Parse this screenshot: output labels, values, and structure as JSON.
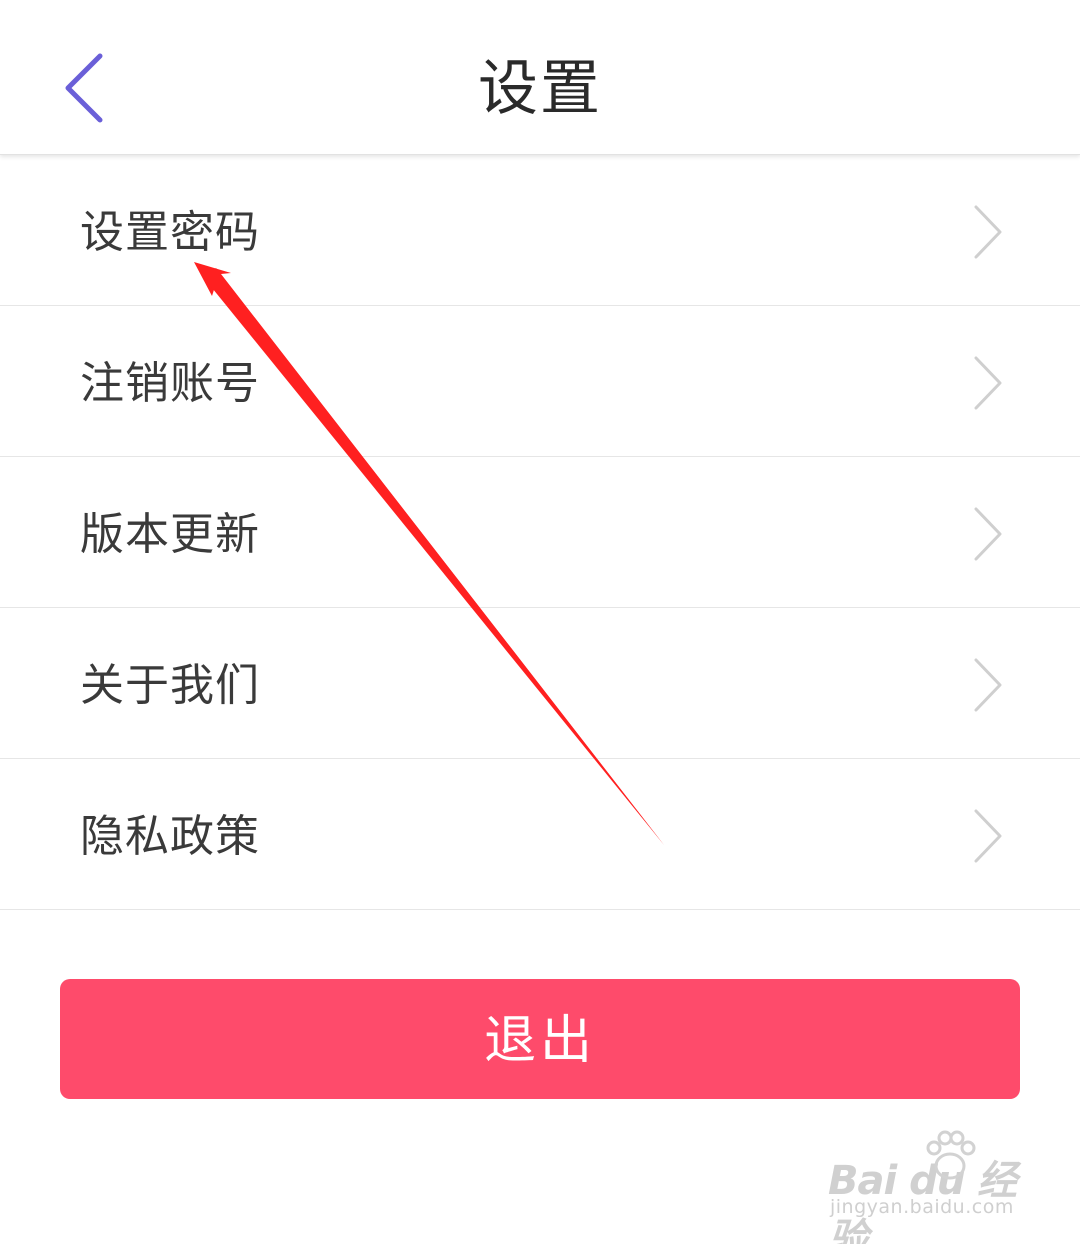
{
  "header": {
    "title": "设置",
    "back_icon": "chevron-left-icon",
    "back_color": "#6a5fd8"
  },
  "menu": {
    "items": [
      {
        "label": "设置密码",
        "icon": "chevron-right-icon"
      },
      {
        "label": "注销账号",
        "icon": "chevron-right-icon"
      },
      {
        "label": "版本更新",
        "icon": "chevron-right-icon"
      },
      {
        "label": "关于我们",
        "icon": "chevron-right-icon"
      },
      {
        "label": "隐私政策",
        "icon": "chevron-right-icon"
      }
    ]
  },
  "logout": {
    "label": "退出",
    "color": "#fe4b6b"
  },
  "annotation": {
    "arrow_color": "#ff2020",
    "arrow_icon": "red-arrow-annotation"
  },
  "watermark": {
    "logo_text": "Bai du 经验",
    "url": "jingyan.baidu.com"
  }
}
